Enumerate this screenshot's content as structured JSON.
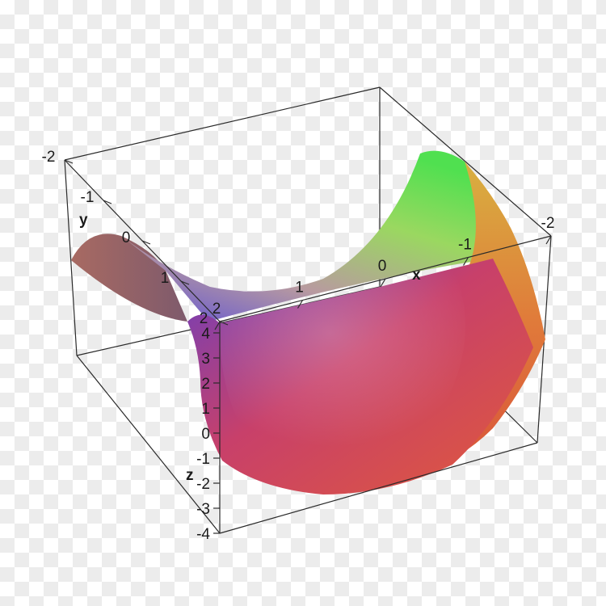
{
  "chart_data": {
    "type": "surface",
    "function": "z = x^2 - y^2",
    "x": {
      "label": "x",
      "range": [
        -2,
        2
      ],
      "ticks": [
        "-2",
        "-1",
        "0",
        "1",
        "2"
      ]
    },
    "y": {
      "label": "y",
      "range": [
        -2,
        2
      ],
      "ticks": [
        "-2",
        "-1",
        "0",
        "1",
        "2"
      ]
    },
    "z": {
      "label": "z",
      "range": [
        -4,
        4
      ],
      "ticks": [
        "-4",
        "-3",
        "-2",
        "-1",
        "0",
        "1",
        "2",
        "3",
        "4"
      ]
    },
    "colormap": [
      "#4040d8",
      "#8a3fb8",
      "#d8403a",
      "#e8703a",
      "#e0a040",
      "#90d040",
      "#40e050"
    ]
  }
}
